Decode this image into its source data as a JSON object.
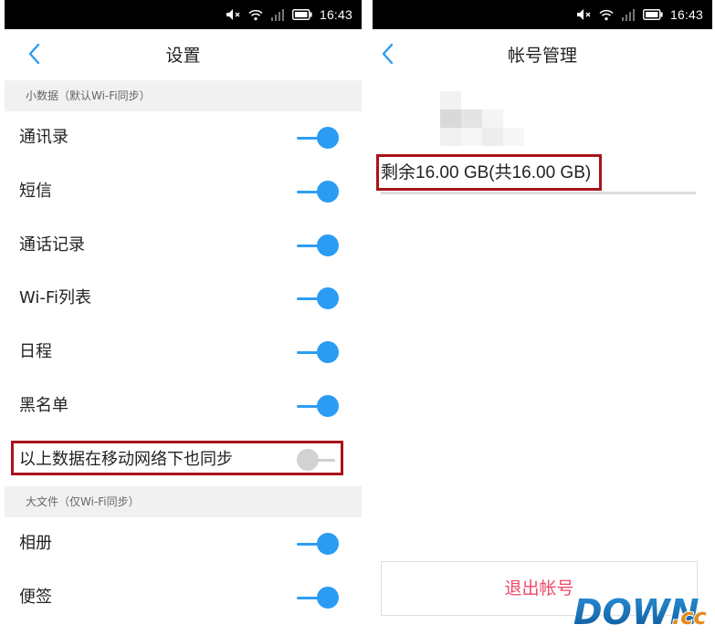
{
  "status_bar": {
    "time": "16:43"
  },
  "left_screen": {
    "title": "设置",
    "section_small": "小数据（默认Wi-Fi同步）",
    "small_items": [
      {
        "label": "通讯录",
        "enabled": true
      },
      {
        "label": "短信",
        "enabled": true
      },
      {
        "label": "通话记录",
        "enabled": true
      },
      {
        "label": "Wi-Fi列表",
        "enabled": true
      },
      {
        "label": "日程",
        "enabled": true
      },
      {
        "label": "黑名单",
        "enabled": true
      }
    ],
    "mobile_sync": {
      "label": "以上数据在移动网络下也同步",
      "enabled": false
    },
    "section_large": "大文件（仅Wi-Fi同步）",
    "large_items": [
      {
        "label": "相册",
        "enabled": true
      },
      {
        "label": "便签",
        "enabled": true
      }
    ]
  },
  "right_screen": {
    "title": "帐号管理",
    "storage": "剩余16.00 GB(共16.00 GB)",
    "storage_remaining_fraction": 1.0,
    "logout": "退出帐号"
  },
  "watermark": {
    "text_main": "DOWN",
    "text_suffix": ".cc"
  },
  "colors": {
    "accent_blue": "#2b9cf3",
    "highlight_red": "#a8131a",
    "logout_pink": "#f04a68",
    "section_bg": "#f1f1f1"
  },
  "icons": [
    "mute-icon",
    "wifi-icon",
    "signal-icon",
    "battery-icon",
    "back-chevron-icon"
  ]
}
